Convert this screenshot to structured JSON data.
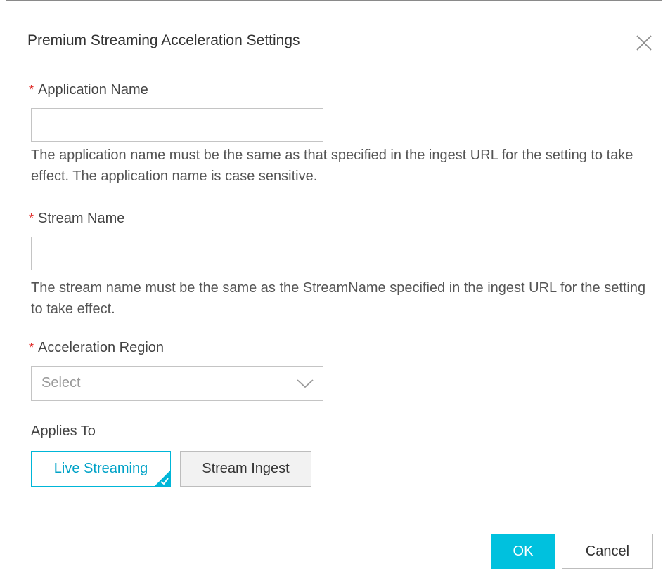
{
  "dialog": {
    "title": "Premium Streaming Acceleration Settings",
    "close_icon": "close-icon"
  },
  "application_name": {
    "required_mark": "*",
    "label": "Application Name",
    "value": "",
    "placeholder": "",
    "hint": "The application name must be the same as that specified in the ingest URL for the setting to take effect. The application name is case sensitive."
  },
  "stream_name": {
    "required_mark": "*",
    "label": "Stream Name",
    "value": "",
    "placeholder": "",
    "hint": "The stream name must be the same as the StreamName specified in the ingest URL for the setting to take effect."
  },
  "acceleration_region": {
    "required_mark": "*",
    "label": "Acceleration Region",
    "selected": "Select",
    "icon": "chevron-down-icon"
  },
  "applies_to": {
    "label": "Applies To",
    "options": [
      {
        "label": "Live Streaming",
        "selected": true,
        "icon": "checkmark-icon"
      },
      {
        "label": "Stream Ingest",
        "selected": false
      }
    ]
  },
  "footer": {
    "ok_label": "OK",
    "cancel_label": "Cancel"
  },
  "colors": {
    "accent": "#00c1de",
    "required": "#e0302d",
    "selected_text": "#00a2c7"
  }
}
